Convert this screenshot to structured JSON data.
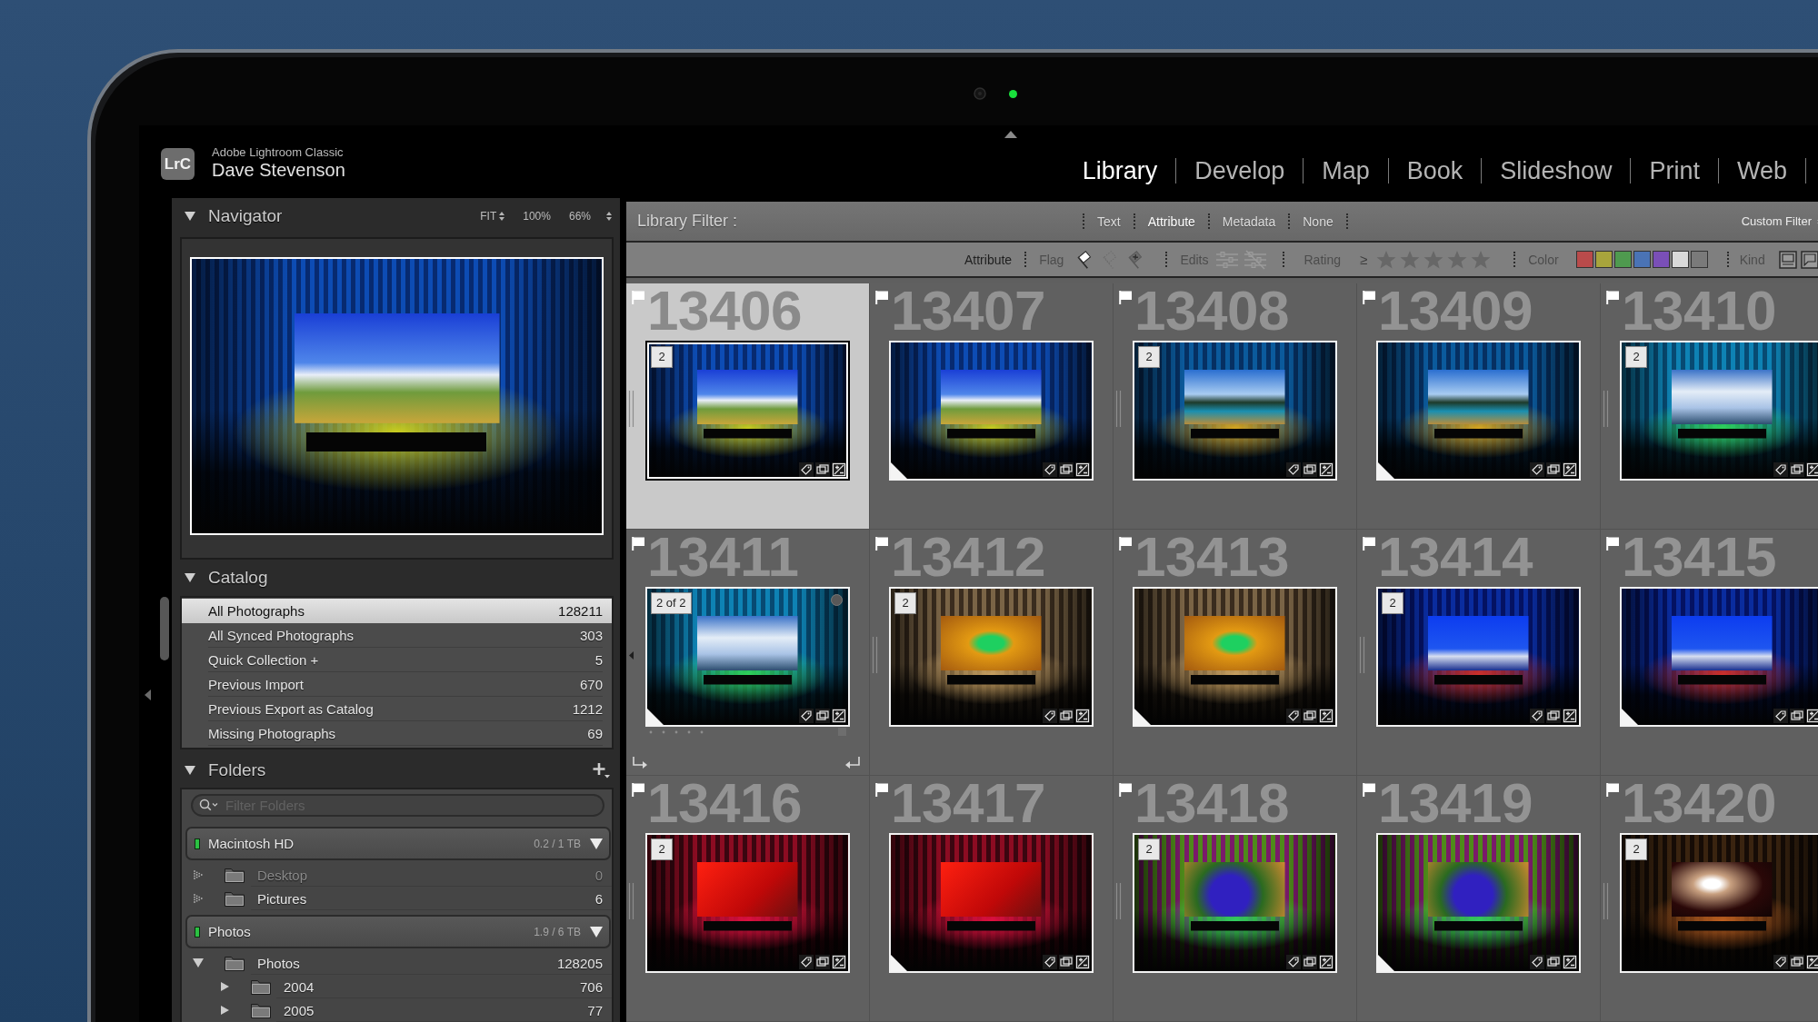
{
  "header": {
    "logo": "LrC",
    "product": "Adobe Lightroom Classic",
    "user": "Dave Stevenson",
    "modules": [
      {
        "label": "Library",
        "selected": true
      },
      {
        "label": "Develop",
        "selected": false
      },
      {
        "label": "Map",
        "selected": false
      },
      {
        "label": "Book",
        "selected": false
      },
      {
        "label": "Slideshow",
        "selected": false
      },
      {
        "label": "Print",
        "selected": false
      },
      {
        "label": "Web",
        "selected": false
      }
    ]
  },
  "navigator": {
    "title": "Navigator",
    "expanded": true,
    "zoom_options": [
      "FIT",
      "100%",
      "66%"
    ]
  },
  "catalog": {
    "title": "Catalog",
    "expanded": true,
    "items": [
      {
        "label": "All Photographs",
        "count": "128211",
        "selected": true
      },
      {
        "label": "All Synced Photographs",
        "count": "303",
        "selected": false
      },
      {
        "label": "Quick Collection +",
        "count": "5",
        "selected": false
      },
      {
        "label": "Previous Import",
        "count": "670",
        "selected": false
      },
      {
        "label": "Previous Export as Catalog",
        "count": "1212",
        "selected": false
      },
      {
        "label": "Missing Photographs",
        "count": "69",
        "selected": false
      }
    ]
  },
  "folders": {
    "title": "Folders",
    "expanded": true,
    "search": {
      "placeholder": "Filter Folders"
    },
    "volumes": [
      {
        "name": "Macintosh HD",
        "usage": "0.2 / 1 TB",
        "expanded": true,
        "folders": [
          {
            "name": "Desktop",
            "count": "0",
            "kind": "dotted",
            "expanded": false,
            "disabled": true
          },
          {
            "name": "Pictures",
            "count": "6",
            "kind": "dotted",
            "expanded": false,
            "disabled": false
          }
        ]
      },
      {
        "name": "Photos",
        "usage": "1.9 / 6 TB",
        "expanded": true,
        "folders": [
          {
            "name": "Photos",
            "count": "128205",
            "kind": "solid",
            "expanded": true,
            "disabled": false,
            "children": [
              {
                "name": "2004",
                "count": "706",
                "kind": "solid",
                "expanded": false,
                "disabled": false
              },
              {
                "name": "2005",
                "count": "77",
                "kind": "solid",
                "expanded": false,
                "disabled": false
              }
            ]
          }
        ]
      }
    ]
  },
  "library_filter": {
    "title": "Library Filter :",
    "tabs": [
      {
        "label": "Text",
        "selected": false
      },
      {
        "label": "Attribute",
        "selected": true
      },
      {
        "label": "Metadata",
        "selected": false
      },
      {
        "label": "None",
        "selected": false
      }
    ],
    "preset": "Custom Filter"
  },
  "attribute_bar": {
    "title": "Attribute",
    "flag_label": "Flag",
    "flags": [
      {
        "kind": "flagged",
        "selected": true
      },
      {
        "kind": "unflagged",
        "selected": false
      },
      {
        "kind": "rejected",
        "selected": false
      }
    ],
    "edits_label": "Edits",
    "edits": [
      {
        "kind": "edited",
        "selected": false
      },
      {
        "kind": "unedited",
        "selected": false
      }
    ],
    "rating_label": "Rating",
    "rating_operator": "≥",
    "stars": 0,
    "color_label": "Color",
    "colors": [
      {
        "color": "#b94b4b",
        "selected": false
      },
      {
        "color": "#a8a43c",
        "selected": false
      },
      {
        "color": "#4f9a4f",
        "selected": false
      },
      {
        "color": "#4a73b5",
        "selected": false
      },
      {
        "color": "#7a4fb7",
        "selected": false
      },
      {
        "color": "#d9d9d9",
        "selected": false
      },
      {
        "color": "#7a7a7a",
        "selected": false
      }
    ],
    "kind_label": "Kind"
  },
  "grid": {
    "cells": [
      {
        "number": "13406",
        "selected": true,
        "badge": "2",
        "virtual_copy": false,
        "hovered": false
      },
      {
        "number": "13407",
        "selected": false,
        "virtual_copy": true,
        "hovered": false
      },
      {
        "number": "13408",
        "selected": false,
        "badge": "2",
        "virtual_copy": false,
        "hovered": false
      },
      {
        "number": "13409",
        "selected": false,
        "virtual_copy": true,
        "hovered": false
      },
      {
        "number": "13410",
        "selected": false,
        "badge": "2",
        "virtual_copy": false,
        "hovered": false
      },
      {
        "number": "13411",
        "selected": false,
        "badge": "2 of 2",
        "virtual_copy": true,
        "hovered": true
      },
      {
        "number": "13412",
        "selected": false,
        "badge": "2",
        "virtual_copy": false,
        "hovered": false
      },
      {
        "number": "13413",
        "selected": false,
        "virtual_copy": true,
        "hovered": false
      },
      {
        "number": "13414",
        "selected": false,
        "badge": "2",
        "virtual_copy": false,
        "hovered": false
      },
      {
        "number": "13415",
        "selected": false,
        "virtual_copy": true,
        "hovered": false
      },
      {
        "number": "13416",
        "selected": false,
        "badge": "2",
        "virtual_copy": false,
        "hovered": false
      },
      {
        "number": "13417",
        "selected": false,
        "virtual_copy": true,
        "hovered": false
      },
      {
        "number": "13418",
        "selected": false,
        "badge": "2",
        "virtual_copy": false,
        "hovered": false
      },
      {
        "number": "13419",
        "selected": false,
        "virtual_copy": true,
        "hovered": false
      },
      {
        "number": "13420",
        "selected": false,
        "badge": "2",
        "virtual_copy": false,
        "hovered": false
      }
    ]
  }
}
